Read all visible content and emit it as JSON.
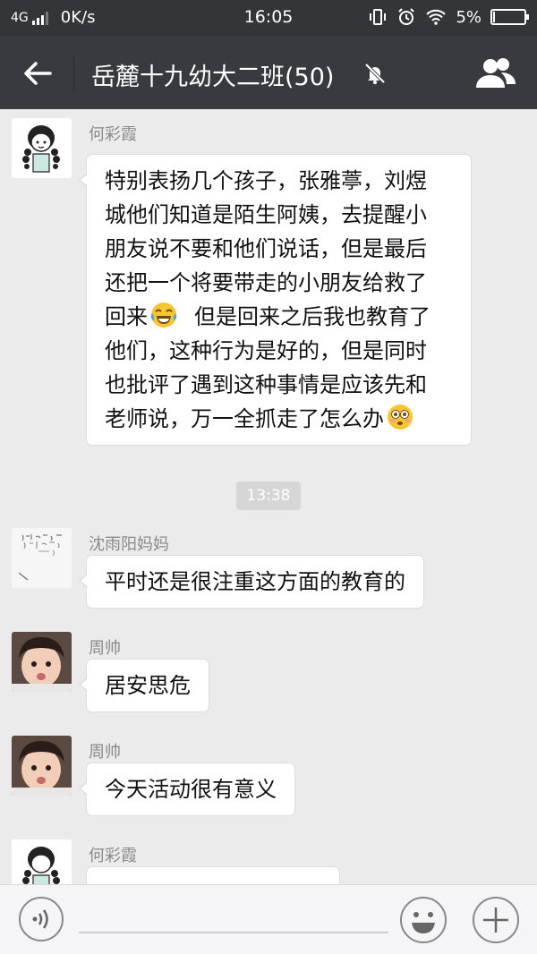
{
  "status_bar": {
    "network": "4G",
    "speed": "0K/s",
    "time": "16:05",
    "battery": "5%",
    "battery_level": 0.05
  },
  "header": {
    "title": "岳麓十九幼大二班(50)",
    "back_icon": "back-arrow-icon",
    "mute_icon": "bell-muted-icon",
    "members_icon": "group-members-icon"
  },
  "messages": [
    {
      "sender": "何彩霞",
      "lines": [
        "特别表扬几个孩子，张雅葶，刘煜",
        "城他们知道是陌生阿姨，去提醒小",
        "朋友说不要和他们说话，但是最后",
        "还把一个将要带走的小朋友给救了",
        "回来",
        "但是回来之后我也教育了",
        "他们，这种行为是好的，但是同时",
        "也批评了遇到这种事情是应该先和",
        "老师说，万一全抓走了怎么办"
      ]
    },
    {
      "timestamp": "13:38"
    },
    {
      "sender": "沈雨阳妈妈",
      "text": "平时还是很注重这方面的教育的"
    },
    {
      "sender": "周帅",
      "text": "居安思危"
    },
    {
      "sender": "周帅",
      "text": "今天活动很有意义"
    },
    {
      "sender": "何彩霞",
      "text": ""
    }
  ],
  "colors": {
    "nav_bg": "#393a3f",
    "status_bg": "#343538",
    "chat_bg": "#ebebeb",
    "bubble_bg": "#ffffff"
  }
}
